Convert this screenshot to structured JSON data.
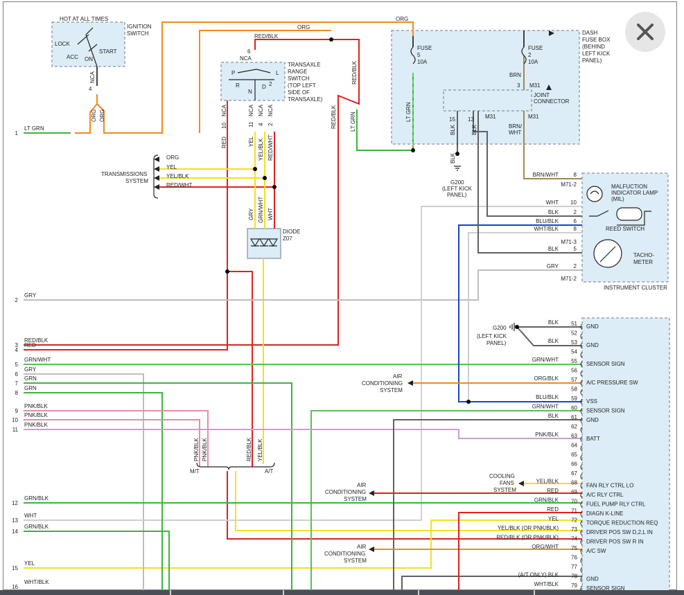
{
  "window": {
    "close_label": "Close"
  },
  "ignition": {
    "title1": "HOT AT ALL TIMES",
    "title2": "IGNITION",
    "title3": "SWITCH",
    "lock": "LOCK",
    "acc": "ACC",
    "on": "ON",
    "start": "START",
    "nca": "NCA",
    "pin": "4"
  },
  "dash_fuse_box": {
    "l1": "DASH",
    "l2": "FUSE BOX",
    "l3": "(BEHIND",
    "l4": "LEFT KICK",
    "l5": "PANEL)"
  },
  "fuse5": {
    "name": "FUSE",
    "num": "5",
    "amp": "10A"
  },
  "fuse2": {
    "name": "FUSE",
    "num": "2",
    "amp": "10A"
  },
  "joint_connector": {
    "l1": "JOINT",
    "l2": "CONNECTOR",
    "pin3": "3",
    "m31": "M31",
    "p15": "15",
    "p13": "13"
  },
  "transaxle_switch": {
    "l1": "TRANSAXLE",
    "l2": "RANGE",
    "l3": "SWITCH",
    "l4": "(TOP LEFT",
    "l5": "SIDE OF",
    "l6": "TRANSAXLE)",
    "p": "P",
    "l": "L",
    "r": "R",
    "n": "N",
    "d": "D",
    "two": "2",
    "nca": "NCA",
    "pin6": "6",
    "pin10": "10",
    "pin11": "11",
    "pin4": "4",
    "pin2": "2"
  },
  "transmission_system": {
    "l1": "TRANSMISSIONS",
    "l2": "SYSTEM"
  },
  "diode": {
    "l1": "DIODE",
    "l2": "Z07"
  },
  "ground_g200": {
    "name": "G200",
    "l1": "(LEFT KICK",
    "l2": "PANEL)"
  },
  "ground_g200b": {
    "name": "G200",
    "l1": "(LEFT KICK",
    "l2": "PANEL)"
  },
  "instrument_cluster": {
    "title": "INSTRUMENT CLUSTER",
    "mil1": "MALFUCTION",
    "mil2": "INDICATOR LAMP",
    "mil3": "(MIL)",
    "reed": "REED SWITCH",
    "tacho1": "TACHO-",
    "tacho2": "METER"
  },
  "ac_system": {
    "l1": "AIR",
    "l2": "CONDITIONING",
    "l3": "SYSTEM"
  },
  "cooling_fans": {
    "l1": "COOLING",
    "l2": "FANS",
    "l3": "SYSTEM"
  },
  "mt_at": {
    "mt": "M/T",
    "at": "A/T"
  },
  "wire_colors": {
    "org": "ORG",
    "red_blk": "RED/BLK",
    "lt_grn": "LT GRN",
    "brn": "BRN",
    "brn_wht": "BRN/\nWHT",
    "blk": "BLK",
    "red": "RED",
    "yel": "YEL",
    "yel_blk": "YEL/BLK",
    "red_wht": "RED/WHT",
    "gry": "GRY",
    "grn_wht": "GRN/WHT",
    "wht": "WHT",
    "pnk_blk": "PNK/BLK",
    "blu_blk": "BLU/BLK",
    "wht_blk": "WHT/BLK",
    "grn": "GRN",
    "grn_blk": "GRN/BLK",
    "org_blk": "ORG/BLK",
    "org_wht": "ORG/WHT"
  },
  "left_pins": [
    {
      "n": "1",
      "label": "LT GRN"
    },
    {
      "n": "2",
      "label": "GRY"
    },
    {
      "n": "3",
      "label": "RED/BLK"
    },
    {
      "n": "4",
      "label": "RED"
    },
    {
      "n": "5",
      "label": "GRN/WHT"
    },
    {
      "n": "6",
      "label": "GRY"
    },
    {
      "n": "7",
      "label": "GRN"
    },
    {
      "n": "8",
      "label": "GRN"
    },
    {
      "n": "9",
      "label": "PNK/BLK"
    },
    {
      "n": "10",
      "label": "PNK/BLK"
    },
    {
      "n": "11",
      "label": "PNK/BLK"
    },
    {
      "n": "12",
      "label": "GRN/BLK"
    },
    {
      "n": "13",
      "label": "WHT"
    },
    {
      "n": "14",
      "label": "GRN/BLK"
    },
    {
      "n": "15",
      "label": "YEL"
    },
    {
      "n": "16",
      "label": "WHT/BLK"
    }
  ],
  "cluster_pins": [
    {
      "n": "8",
      "wire": "BRN/WHT",
      "conn": "M71-2"
    },
    {
      "n": "10",
      "wire": "WHT",
      "conn": ""
    },
    {
      "n": "2",
      "wire": "BLK",
      "conn": ""
    },
    {
      "n": "6",
      "wire": "BLU/BLK",
      "conn": ""
    },
    {
      "n": "8",
      "wire": "WHT/BLK",
      "conn": ""
    },
    {
      "n": "",
      "wire": "",
      "conn": "M71-3"
    },
    {
      "n": "5",
      "wire": "BLK",
      "conn": ""
    },
    {
      "n": "2",
      "wire": "GRY",
      "conn": ""
    },
    {
      "n": "",
      "wire": "",
      "conn": "M71-2"
    }
  ],
  "pcm_pins": [
    {
      "n": "51",
      "wire": "BLK",
      "func": "GND"
    },
    {
      "n": "52",
      "wire": "",
      "func": ""
    },
    {
      "n": "53",
      "wire": "BLK",
      "func": "GND"
    },
    {
      "n": "54",
      "wire": "",
      "func": ""
    },
    {
      "n": "55",
      "wire": "GRN/WHT",
      "func": "SENSOR SIGN"
    },
    {
      "n": "56",
      "wire": "",
      "func": ""
    },
    {
      "n": "57",
      "wire": "ORG/BLK",
      "func": "A/C PRESSURE SW"
    },
    {
      "n": "58",
      "wire": "",
      "func": ""
    },
    {
      "n": "59",
      "wire": "BLU/BLK",
      "func": "VSS"
    },
    {
      "n": "60",
      "wire": "GRN/WHT",
      "func": "SENSOR SIGN"
    },
    {
      "n": "61",
      "wire": "BLK",
      "func": "GND"
    },
    {
      "n": "62",
      "wire": "",
      "func": ""
    },
    {
      "n": "63",
      "wire": "PNK/BLK",
      "func": "BATT"
    },
    {
      "n": "64",
      "wire": "",
      "func": ""
    },
    {
      "n": "65",
      "wire": "",
      "func": ""
    },
    {
      "n": "66",
      "wire": "",
      "func": ""
    },
    {
      "n": "67",
      "wire": "",
      "func": ""
    },
    {
      "n": "68",
      "wire": "YEL/BLK",
      "func": "FAN RLY CTRL LO"
    },
    {
      "n": "69",
      "wire": "RED",
      "func": "A/C RLY CTRL"
    },
    {
      "n": "70",
      "wire": "GRN/BLK",
      "func": "FUEL PUMP RLY CTRL"
    },
    {
      "n": "71",
      "wire": "RED",
      "func": "DIAGN K-LINE"
    },
    {
      "n": "72",
      "wire": "YEL",
      "func": "TORQUE REDUCTION REQ"
    },
    {
      "n": "73",
      "wire": "YEL/BLK (OR PNK/BLK)",
      "func": "DRIVER POS SW D,2,L IN"
    },
    {
      "n": "74",
      "wire": "RED/BLK (OR PNK/BLK)",
      "func": "DRIVER POS SW R IN"
    },
    {
      "n": "75",
      "wire": "ORG/WHT",
      "func": "A/C SW"
    },
    {
      "n": "76",
      "wire": "",
      "func": ""
    },
    {
      "n": "77",
      "wire": "",
      "func": ""
    },
    {
      "n": "78",
      "wire": "(A/T ONLY)  BLK",
      "func": "GND"
    },
    {
      "n": "79",
      "wire": "WHT/BLK",
      "func": "SENSOR SIGN"
    }
  ],
  "colors": {
    "org": "#f08a1e",
    "red": "#e02020",
    "green": "#3cb43c",
    "yellow": "#f2e21a",
    "grey": "#bdbdbd",
    "dkgrey": "#606060",
    "pink": "#e88aa8",
    "blue": "#2040c8",
    "brown": "#a08850",
    "box_fill": "#dcedf7",
    "box_stroke": "#6a7a8a"
  }
}
